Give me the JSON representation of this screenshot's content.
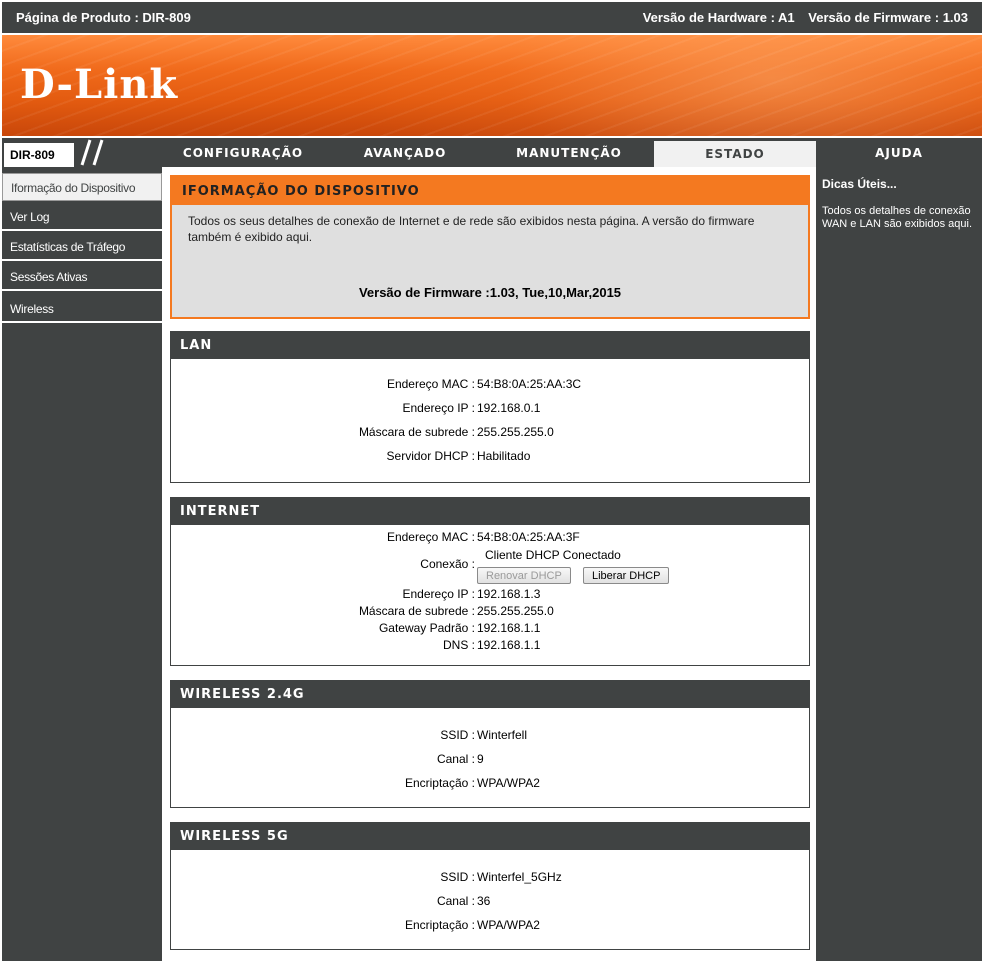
{
  "topbar": {
    "product": "Página de Produto : DIR-809",
    "hardware": "Versão de Hardware : A1",
    "firmware": "Versão de Firmware : 1.03"
  },
  "brand": {
    "logo": "D-Link",
    "accent": "#f47920",
    "dark": "#404343"
  },
  "nav": {
    "model": "DIR-809",
    "tabs": [
      {
        "label": "CONFIGURAÇÃO"
      },
      {
        "label": "AVANÇADO"
      },
      {
        "label": "MANUTENÇÃO"
      },
      {
        "label": "ESTADO"
      },
      {
        "label": "AJUDA"
      }
    ]
  },
  "sidebar": {
    "items": [
      {
        "label": "Iformação do Dispositivo"
      },
      {
        "label": "Ver Log"
      },
      {
        "label": "Estatísticas de Tráfego"
      },
      {
        "label": "Sessões Ativas"
      },
      {
        "label": "Wireless"
      }
    ]
  },
  "help": {
    "title": "Dicas Úteis...",
    "text": "Todos os detalhes de conexão WAN e LAN são exibidos aqui."
  },
  "device_info": {
    "title": "IFORMAÇÃO DO DISPOSITIVO",
    "description": "Todos os seus detalhes de conexão de Internet e de rede são exibidos nesta página. A versão do firmware também é exibido aqui.",
    "firmware_label": "Versão de Firmware :",
    "firmware_value": "1.03,  Tue,10,Mar,2015"
  },
  "lan": {
    "title": "LAN",
    "mac_label": "Endereço MAC :",
    "mac": "54:B8:0A:25:AA:3C",
    "ip_label": "Endereço IP :",
    "ip": "192.168.0.1",
    "mask_label": "Máscara de subrede :",
    "mask": "255.255.255.0",
    "dhcp_label": "Servidor DHCP :",
    "dhcp": "Habilitado"
  },
  "internet": {
    "title": "INTERNET",
    "mac_label": "Endereço MAC :",
    "mac": "54:B8:0A:25:AA:3F",
    "conn_label": "Conexão :",
    "conn": "Cliente DHCP Conectado",
    "renew_button": "Renovar DHCP",
    "release_button": "Liberar DHCP",
    "ip_label": "Endereço IP :",
    "ip": "192.168.1.3",
    "mask_label": "Máscara de subrede :",
    "mask": "255.255.255.0",
    "gw_label": "Gateway Padrão :",
    "gw": "192.168.1.1",
    "dns_label": "DNS :",
    "dns": "192.168.1.1"
  },
  "wireless24": {
    "title": "WIRELESS 2.4G",
    "ssid_label": "SSID :",
    "ssid": "Winterfell",
    "channel_label": "Canal :",
    "channel": "9",
    "enc_label": "Encriptação :",
    "enc": "WPA/WPA2"
  },
  "wireless5": {
    "title": "WIRELESS 5G",
    "ssid_label": "SSID :",
    "ssid": "Winterfel_5GHz",
    "channel_label": "Canal :",
    "channel": "36",
    "enc_label": "Encriptação :",
    "enc": "WPA/WPA2"
  }
}
